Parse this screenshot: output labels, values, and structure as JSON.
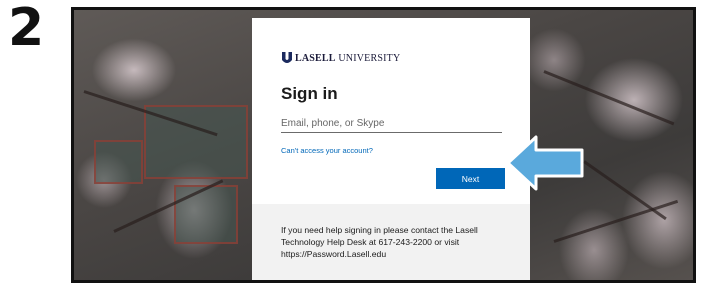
{
  "step": {
    "number": "2"
  },
  "signin": {
    "brand_strong": "LASELL",
    "brand_light": " UNIVERSITY",
    "title": "Sign in",
    "email_placeholder": "Email, phone, or Skype",
    "email_value": "",
    "cant_access_link": "Can't access your account?",
    "next_button": "Next"
  },
  "help": {
    "message": "If you need help signing in please contact the Lasell Technology Help Desk at 617-243-2200 or visit https://Password.Lasell.edu"
  },
  "colors": {
    "accent_blue": "#0067b8",
    "arrow_blue": "#5aa9dc",
    "help_panel": "#f2f2f2",
    "brand_navy": "#1b2a5e"
  },
  "icons": {
    "logo": "lasell-u-logo-icon",
    "arrow": "left-pointing-arrow-icon"
  }
}
